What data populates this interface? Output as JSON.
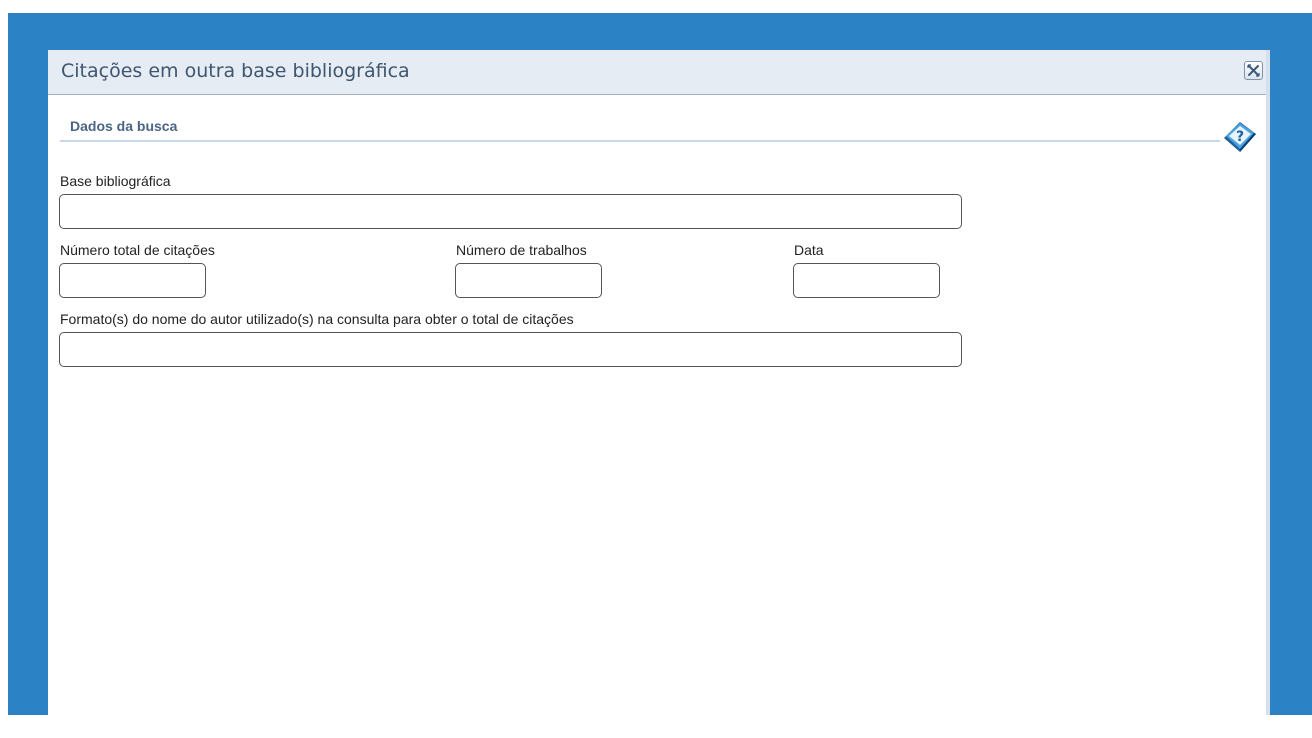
{
  "dialog": {
    "title": "Citações em outra base bibliográfica",
    "close_icon": "close-icon",
    "help_icon": "help-book-icon"
  },
  "section": {
    "title": "Dados da busca"
  },
  "form": {
    "base_label": "Base bibliográfica",
    "base_value": "",
    "total_citations_label": "Número total de citações",
    "total_citations_value": "",
    "works_label": "Número de trabalhos",
    "works_value": "",
    "date_label": "Data",
    "date_value": "",
    "author_format_label": "Formato(s) do nome do autor utilizado(s) na consulta para obter o total de citações",
    "author_format_value": ""
  },
  "colors": {
    "backdrop": "#2b83c5",
    "header_bg": "#e6ecf3",
    "title_text": "#3f5670",
    "section_text": "#4a6585"
  }
}
